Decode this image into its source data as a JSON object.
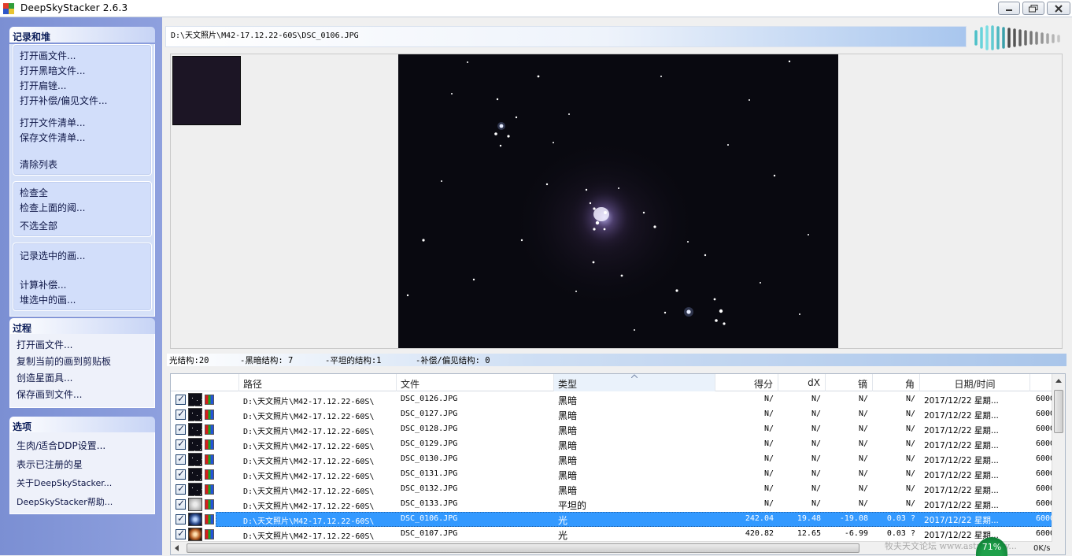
{
  "window": {
    "title": "DeepSkyStacker 2.6.3"
  },
  "sidebar": {
    "group1": {
      "title": "记录和堆",
      "box1": [
        "打开画文件...",
        "打开黑暗文件...",
        "打开扁锉...",
        "打开补偿/偏见文件...",
        "打开文件清单...",
        "保存文件清单...",
        "清除列表"
      ],
      "box2": [
        "检查全",
        "检查上面的阈...",
        "不选全部"
      ],
      "box3": [
        "记录选中的画...",
        "计算补偿...",
        "堆选中的画..."
      ]
    },
    "group2": {
      "title": "过程",
      "items": [
        "打开画文件...",
        "复制当前的画到剪贴板",
        "创造星面具...",
        "保存画到文件..."
      ]
    },
    "group3": {
      "title": "选项",
      "items": [
        "生肉/适合DDP设置...",
        "表示已注册的星",
        "关于DeepSkyStacker...",
        "DeepSkyStacker帮助..."
      ]
    }
  },
  "path_bar": {
    "path": "D:\\天文照片\\M42-17.12.22-60S\\DSC_0106.JPG"
  },
  "info_bar": {
    "light": "光结构:20",
    "dark": "-黑暗结构: 7",
    "flat": "-平坦的结构:1",
    "offset": "-补偿/偏见结构: 0"
  },
  "table": {
    "headers": [
      "路径",
      "文件",
      "类型",
      "得分",
      "dX",
      "镝",
      "角",
      "日期/时间"
    ],
    "rows": [
      {
        "path": "D:\\天文照片\\M42-17.12.22-60S\\",
        "file": "DSC_0126.JPG",
        "type": "黑暗",
        "score": "N/",
        "dx": "N/",
        "dy": "N/",
        "angle": "N/",
        "date": "2017/12/22 星期...",
        "extra": "6000",
        "icon": "dark",
        "selected": false
      },
      {
        "path": "D:\\天文照片\\M42-17.12.22-60S\\",
        "file": "DSC_0127.JPG",
        "type": "黑暗",
        "score": "N/",
        "dx": "N/",
        "dy": "N/",
        "angle": "N/",
        "date": "2017/12/22 星期...",
        "extra": "6000",
        "icon": "dark",
        "selected": false
      },
      {
        "path": "D:\\天文照片\\M42-17.12.22-60S\\",
        "file": "DSC_0128.JPG",
        "type": "黑暗",
        "score": "N/",
        "dx": "N/",
        "dy": "N/",
        "angle": "N/",
        "date": "2017/12/22 星期...",
        "extra": "6000",
        "icon": "dark",
        "selected": false
      },
      {
        "path": "D:\\天文照片\\M42-17.12.22-60S\\",
        "file": "DSC_0129.JPG",
        "type": "黑暗",
        "score": "N/",
        "dx": "N/",
        "dy": "N/",
        "angle": "N/",
        "date": "2017/12/22 星期...",
        "extra": "6000",
        "icon": "dark",
        "selected": false
      },
      {
        "path": "D:\\天文照片\\M42-17.12.22-60S\\",
        "file": "DSC_0130.JPG",
        "type": "黑暗",
        "score": "N/",
        "dx": "N/",
        "dy": "N/",
        "angle": "N/",
        "date": "2017/12/22 星期...",
        "extra": "6000",
        "icon": "dark",
        "selected": false
      },
      {
        "path": "D:\\天文照片\\M42-17.12.22-60S\\",
        "file": "DSC_0131.JPG",
        "type": "黑暗",
        "score": "N/",
        "dx": "N/",
        "dy": "N/",
        "angle": "N/",
        "date": "2017/12/22 星期...",
        "extra": "6000",
        "icon": "dark",
        "selected": false
      },
      {
        "path": "D:\\天文照片\\M42-17.12.22-60S\\",
        "file": "DSC_0132.JPG",
        "type": "黑暗",
        "score": "N/",
        "dx": "N/",
        "dy": "N/",
        "angle": "N/",
        "date": "2017/12/22 星期...",
        "extra": "6000",
        "icon": "dark",
        "selected": false
      },
      {
        "path": "D:\\天文照片\\M42-17.12.22-60S\\",
        "file": "DSC_0133.JPG",
        "type": "平坦的",
        "score": "N/",
        "dx": "N/",
        "dy": "N/",
        "angle": "N/",
        "date": "2017/12/22 星期...",
        "extra": "6000",
        "icon": "flat",
        "selected": false
      },
      {
        "path": "D:\\天文照片\\M42-17.12.22-60S\\",
        "file": "DSC_0106.JPG",
        "type": "光",
        "score": "242.04",
        "dx": "19.48",
        "dy": "-19.08",
        "angle": "0.03 ?",
        "date": "2017/12/22 星期...",
        "extra": "6000",
        "icon": "light1",
        "selected": true
      },
      {
        "path": "D:\\天文照片\\M42-17.12.22-60S\\",
        "file": "DSC_0107.JPG",
        "type": "光",
        "score": "420.82",
        "dx": "12.65",
        "dy": "-6.99",
        "angle": "0.03 ?",
        "date": "2017/12/22 星期...",
        "extra": "6000",
        "icon": "light2",
        "selected": false
      }
    ]
  },
  "statusbar": {
    "watermark": "牧夫天文论坛 www.astronomy...",
    "net_percent": "71%",
    "speed": "0K/s"
  },
  "colors": {
    "sidebar": "#8ea0de",
    "selection": "#3399ff",
    "image_bg": "#090910"
  }
}
